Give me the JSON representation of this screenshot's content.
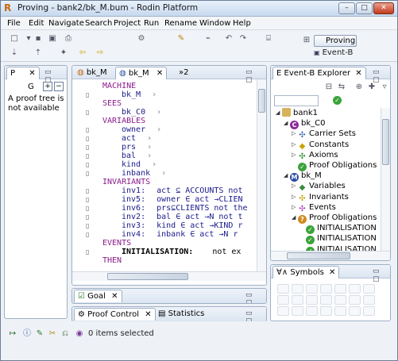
{
  "window": {
    "title": "Proving - bank2/bk_M.bum - Rodin Platform",
    "min": "–",
    "max": "□",
    "close": "✕"
  },
  "menu": [
    "File",
    "Edit",
    "Navigate",
    "Search",
    "Project",
    "Run",
    "Rename",
    "Window",
    "Help"
  ],
  "perspectives": {
    "active": "Proving",
    "other": "Event-B"
  },
  "proof_tree": {
    "tab": "P",
    "close": "✕",
    "toolbar_label": "G",
    "message": "A proof tree is not available"
  },
  "editor": {
    "tabs": [
      "bk_M",
      "bk_M",
      "»2"
    ],
    "lines": [
      {
        "kind": "kw",
        "text": "MACHINE"
      },
      {
        "kind": "id",
        "text": "bk_M"
      },
      {
        "kind": "kw",
        "text": "SEES"
      },
      {
        "kind": "id",
        "text": "bk_C0"
      },
      {
        "kind": "kw",
        "text": "VARIABLES"
      },
      {
        "kind": "id",
        "text": "owner"
      },
      {
        "kind": "id",
        "text": "act"
      },
      {
        "kind": "id",
        "text": "prs"
      },
      {
        "kind": "id",
        "text": "bal"
      },
      {
        "kind": "id",
        "text": "kind"
      },
      {
        "kind": "id",
        "text": "inbank"
      },
      {
        "kind": "kw",
        "text": "INVARIANTS"
      },
      {
        "kind": "inv",
        "label": "inv1:",
        "text": "act ⊆ ACCOUNTS not"
      },
      {
        "kind": "inv",
        "label": "inv5:",
        "text": "owner ∈ act →CLIEN"
      },
      {
        "kind": "inv",
        "label": "inv6:",
        "text": "prs⊆CLIENTS not the"
      },
      {
        "kind": "inv",
        "label": "inv2:",
        "text": "bal ∈ act →N not t"
      },
      {
        "kind": "inv",
        "label": "inv3:",
        "text": "kind ∈ act →KIND r"
      },
      {
        "kind": "inv",
        "label": "inv4:",
        "text": "inbank ∈  act →N r"
      },
      {
        "kind": "kw",
        "text": "EVENTS"
      },
      {
        "kind": "evt",
        "text": "INITIALISATION:",
        "extra": "not ex"
      },
      {
        "kind": "kw",
        "text": "THEN"
      }
    ]
  },
  "goal_view": {
    "tab": "Goal"
  },
  "proof_control": {
    "tabs": [
      "Proof Control",
      "Statistics"
    ]
  },
  "explorer": {
    "tab": "Event-B Explorer",
    "tree": [
      {
        "level": 0,
        "arrow": "◢",
        "icon": "folder",
        "label": "bank1"
      },
      {
        "level": 1,
        "arrow": "◢",
        "icon": "context",
        "label": "bk_C0"
      },
      {
        "level": 2,
        "arrow": "▷",
        "icon": "carrier",
        "label": "Carrier Sets"
      },
      {
        "level": 2,
        "arrow": "▷",
        "icon": "constant",
        "label": "Constants"
      },
      {
        "level": 2,
        "arrow": "▷",
        "icon": "axiom",
        "label": "Axioms"
      },
      {
        "level": 2,
        "arrow": "",
        "icon": "po",
        "label": "Proof Obligations"
      },
      {
        "level": 1,
        "arrow": "◢",
        "icon": "machine",
        "label": "bk_M"
      },
      {
        "level": 2,
        "arrow": "▷",
        "icon": "variable",
        "label": "Variables"
      },
      {
        "level": 2,
        "arrow": "▷",
        "icon": "invariant",
        "label": "Invariants"
      },
      {
        "level": 2,
        "arrow": "▷",
        "icon": "event",
        "label": "Events"
      },
      {
        "level": 2,
        "arrow": "◢",
        "icon": "po-pending",
        "label": "Proof Obligations"
      },
      {
        "level": 3,
        "arrow": "",
        "icon": "po-ok",
        "label": "INITIALISATION"
      },
      {
        "level": 3,
        "arrow": "",
        "icon": "po-ok",
        "label": "INITIALISATION"
      },
      {
        "level": 3,
        "arrow": "",
        "icon": "po-ok",
        "label": "INITIALISATION"
      }
    ]
  },
  "symbols": {
    "tab": "Symbols"
  },
  "status": {
    "text": "0 items selected"
  },
  "colors": {
    "keyword": "#8b1a8b",
    "identifier": "#1a1a8b",
    "titlebar": "#c7d9ee"
  }
}
